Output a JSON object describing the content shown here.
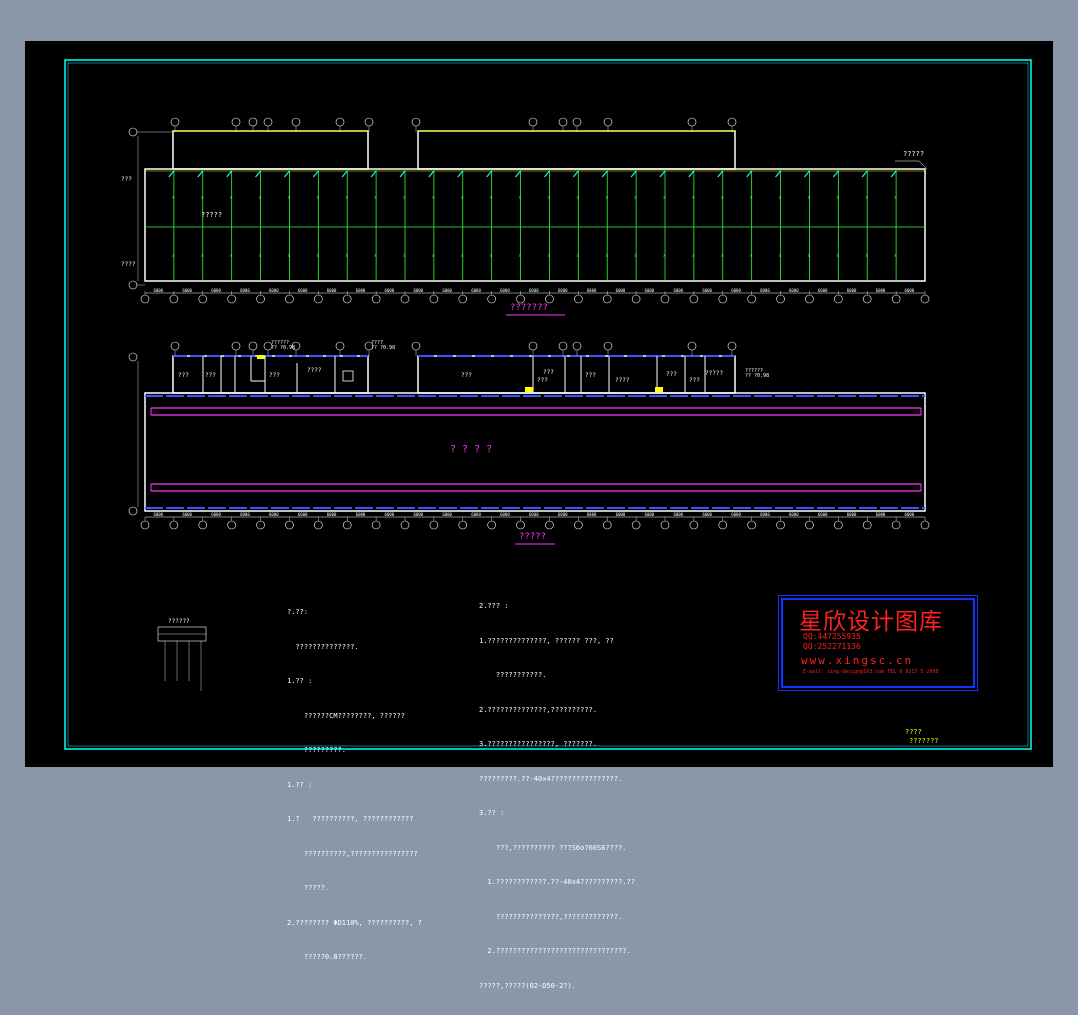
{
  "drawing": {
    "plan1_caption": "???????",
    "plan2_caption": "?????",
    "plan2_center_label": "? ? ? ?",
    "upper_annex_label": "?????",
    "top_right_tag": "?????",
    "left_dim_labels": [
      "???",
      "????"
    ],
    "room_labels": [
      "???",
      "???",
      "???",
      "????",
      "???",
      "???",
      "????",
      "???",
      "???",
      "???",
      "???",
      "?????"
    ],
    "callouts": [
      "??????\n?? ?0.98",
      "????\n?? ?0.98",
      "??????\n?? ?0.98"
    ],
    "bay_label": "6000",
    "legend_title": "??????"
  },
  "notes_left": {
    "lines": [
      "?.??:",
      "  ??????????????.",
      "1.?? :",
      "    ??????CM????????, ??????",
      "    ?????????.",
      "1.?? :",
      "1.?   ??????????, ????????????",
      "    ??????????,????????????????",
      "    ?????.",
      "2.???????? ΦD110%, ??????????, ?",
      "    ?????0.8??????."
    ]
  },
  "notes_right": {
    "lines": [
      "2.??? :",
      "1.??????????????, ?????? ???, ??",
      "    ???????????.",
      "2.??????????????,??????????.",
      "3.????????????????, ???????.",
      "?????????.??-40x4????????????????.",
      "3.?? :",
      "    ???,?????????? ???S6o?60S6????.",
      "  1.????????????.??-40x4??????????.??",
      "    ???????????????,?????????????.",
      "  2.???????????????????????????????.",
      "?????,?????(02-D50-2?)."
    ]
  },
  "stamp": {
    "title": "星欣设计图库",
    "qq1": "QQ:447255935",
    "qq2": "QQ:252271136",
    "website": "www.xingsc.cn",
    "footer": "E-mail: xing-design@163.com   TEL 0 8117 5 2060"
  },
  "title_block": {
    "line1": "????",
    "line2": "???????"
  },
  "colors": {
    "background": "#000000",
    "outer_mat": "#8a97a8",
    "border": "#00ffff",
    "wall": "#ffffff",
    "grid_green": "#33ff33",
    "annotation_yellow": "#ffff00",
    "accent_magenta": "#ff33ff",
    "stamp_red": "#ff2020",
    "stamp_blue": "#1133ff"
  }
}
